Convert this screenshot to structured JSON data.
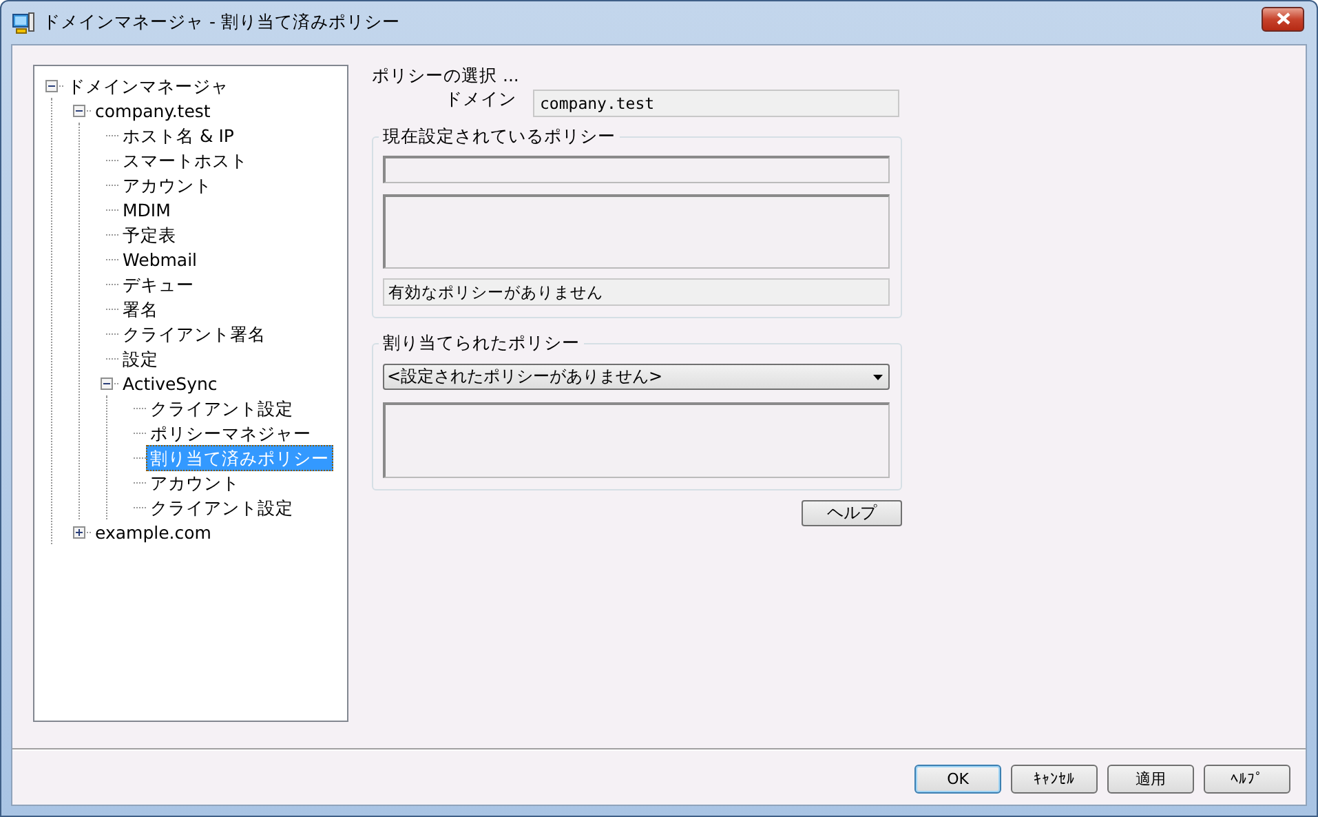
{
  "window": {
    "title": "ドメインマネージャ - 割り当て済みポリシー"
  },
  "tree": [
    {
      "label": "ドメインマネージャ",
      "selected": false,
      "expanded": true,
      "children": [
        {
          "label": "company.test",
          "selected": false,
          "expanded": true,
          "children": [
            {
              "label": "ホスト名 & IP",
              "selected": false
            },
            {
              "label": "スマートホスト",
              "selected": false
            },
            {
              "label": "アカウント",
              "selected": false
            },
            {
              "label": "MDIM",
              "selected": false
            },
            {
              "label": "予定表",
              "selected": false
            },
            {
              "label": "Webmail",
              "selected": false
            },
            {
              "label": "デキュー",
              "selected": false
            },
            {
              "label": "署名",
              "selected": false
            },
            {
              "label": "クライアント署名",
              "selected": false
            },
            {
              "label": "設定",
              "selected": false
            },
            {
              "label": "ActiveSync",
              "selected": false,
              "expanded": true,
              "children": [
                {
                  "label": "クライアント設定",
                  "selected": false
                },
                {
                  "label": "ポリシーマネジャー",
                  "selected": false
                },
                {
                  "label": "割り当て済みポリシー",
                  "selected": true
                },
                {
                  "label": "アカウント",
                  "selected": false
                },
                {
                  "label": "クライアント設定",
                  "selected": false
                }
              ]
            }
          ]
        },
        {
          "label": "example.com",
          "selected": false,
          "expanded": false
        }
      ]
    }
  ],
  "panel": {
    "heading": "ポリシーの選択 ...",
    "domain_label": "ドメイン",
    "domain_value": "company.test",
    "current_policy": {
      "legend": "現在設定されているポリシー",
      "status": "有効なポリシーがありません"
    },
    "assigned_policy": {
      "legend": "割り当てられたポリシー",
      "dropdown_value": "<設定されたポリシーがありません>"
    },
    "help_button": "ヘルプ"
  },
  "buttons": [
    {
      "label": "OK",
      "default": true
    },
    {
      "label": "ｷｬﾝｾﾙ",
      "default": false
    },
    {
      "label": "適用",
      "default": false
    },
    {
      "label": "ﾍﾙﾌﾟ",
      "default": false
    }
  ]
}
